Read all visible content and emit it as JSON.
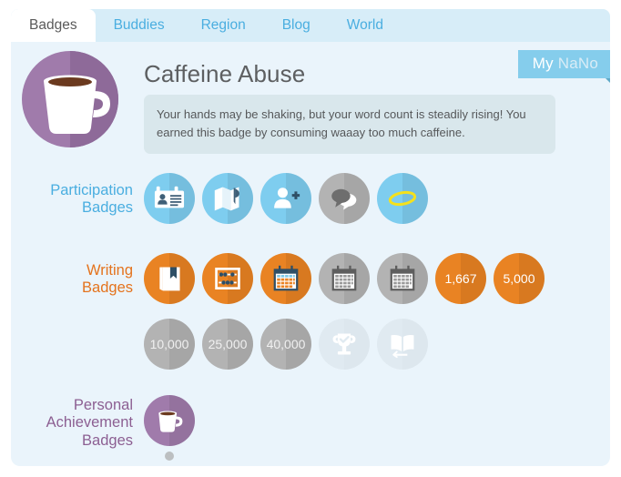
{
  "tabs": [
    {
      "label": "Badges",
      "active": true
    },
    {
      "label": "Buddies",
      "active": false
    },
    {
      "label": "Region",
      "active": false
    },
    {
      "label": "Blog",
      "active": false
    },
    {
      "label": "World",
      "active": false
    }
  ],
  "nano_flag": {
    "primary": "My",
    "secondary": "NaNo"
  },
  "header": {
    "title": "Caffeine Abuse",
    "description": "Your hands may be shaking, but your word count is steadily rising! You earned this badge by consuming waaay too much caffeine.",
    "badge_icon": "coffee-cup-icon",
    "badge_color": "#a07bab"
  },
  "colors": {
    "participation": "#4aaee0",
    "writing": "#e4731d",
    "personal": "#8c5f92",
    "blue_badge": "#7ecdef",
    "gray_badge": "#b3b3b3",
    "orange_badge": "#e98323",
    "faded_badge": "#e0eaf1",
    "purple_badge": "#a07bab",
    "panel_bg": "#eaf4fb",
    "tabbar_bg": "#d7edf8",
    "desc_bg": "#d9e7ec"
  },
  "sections": [
    {
      "label_line1": "Participation",
      "label_line2": "Badges",
      "label_color": "blue",
      "rows": [
        [
          {
            "icon": "id-card-icon",
            "state": "blue",
            "text": ""
          },
          {
            "icon": "map-icon",
            "state": "blue",
            "text": ""
          },
          {
            "icon": "add-person-icon",
            "state": "blue",
            "text": ""
          },
          {
            "icon": "speech-bubble-icon",
            "state": "gray",
            "text": ""
          },
          {
            "icon": "halo-icon",
            "state": "blue",
            "text": ""
          }
        ]
      ]
    },
    {
      "label_line1": "Writing",
      "label_line2": "Badges",
      "label_color": "orange",
      "rows": [
        [
          {
            "icon": "book-bookmark-icon",
            "state": "orange",
            "text": ""
          },
          {
            "icon": "abacus-icon",
            "state": "orange",
            "text": ""
          },
          {
            "icon": "calendar-icon",
            "state": "orange",
            "text": ""
          },
          {
            "icon": "calendar-icon",
            "state": "gray",
            "text": ""
          },
          {
            "icon": "calendar-icon",
            "state": "gray",
            "text": ""
          },
          {
            "icon": "",
            "state": "orange",
            "text": "1,667"
          },
          {
            "icon": "",
            "state": "orange",
            "text": "5,000"
          }
        ],
        [
          {
            "icon": "",
            "state": "gray",
            "text": "10,000"
          },
          {
            "icon": "",
            "state": "gray",
            "text": "25,000"
          },
          {
            "icon": "",
            "state": "gray",
            "text": "40,000"
          },
          {
            "icon": "trophy-check-icon",
            "state": "faded",
            "text": ""
          },
          {
            "icon": "open-book-arrow-icon",
            "state": "faded",
            "text": ""
          }
        ]
      ]
    },
    {
      "label_line1": "Personal",
      "label_line2": "Achievement",
      "label_line3": "Badges",
      "label_color": "purple",
      "rows": [
        [
          {
            "icon": "coffee-cup-icon",
            "state": "purple",
            "text": "",
            "selected": true
          }
        ]
      ]
    }
  ]
}
